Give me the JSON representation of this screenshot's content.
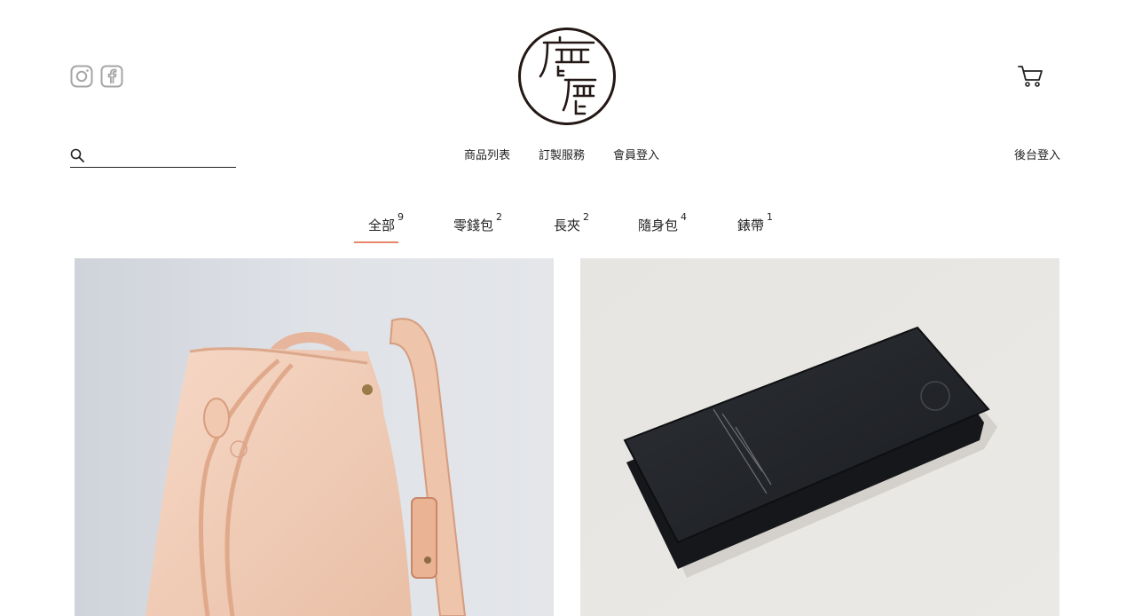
{
  "brand": {
    "logo_chars": "鹿鹿"
  },
  "header": {
    "social": [
      {
        "icon": "instagram-icon"
      },
      {
        "icon": "facebook-icon"
      }
    ],
    "cart_icon": "cart-icon"
  },
  "search": {
    "placeholder": "",
    "value": ""
  },
  "nav": {
    "items": [
      "商品列表",
      "訂製服務",
      "會員登入"
    ],
    "admin_login": "後台登入"
  },
  "categories": [
    {
      "label": "全部",
      "count": "9",
      "active": true
    },
    {
      "label": "零錢包",
      "count": "2",
      "active": false
    },
    {
      "label": "長夾",
      "count": "2",
      "active": false
    },
    {
      "label": "隨身包",
      "count": "4",
      "active": false
    },
    {
      "label": "錶帶",
      "count": "1",
      "active": false
    }
  ],
  "colors": {
    "accent_underline": "#e8866a",
    "text": "#222222"
  },
  "products": [
    {
      "name": "bucket-bag-natural-leather"
    },
    {
      "name": "long-wallet-black-leather"
    }
  ]
}
